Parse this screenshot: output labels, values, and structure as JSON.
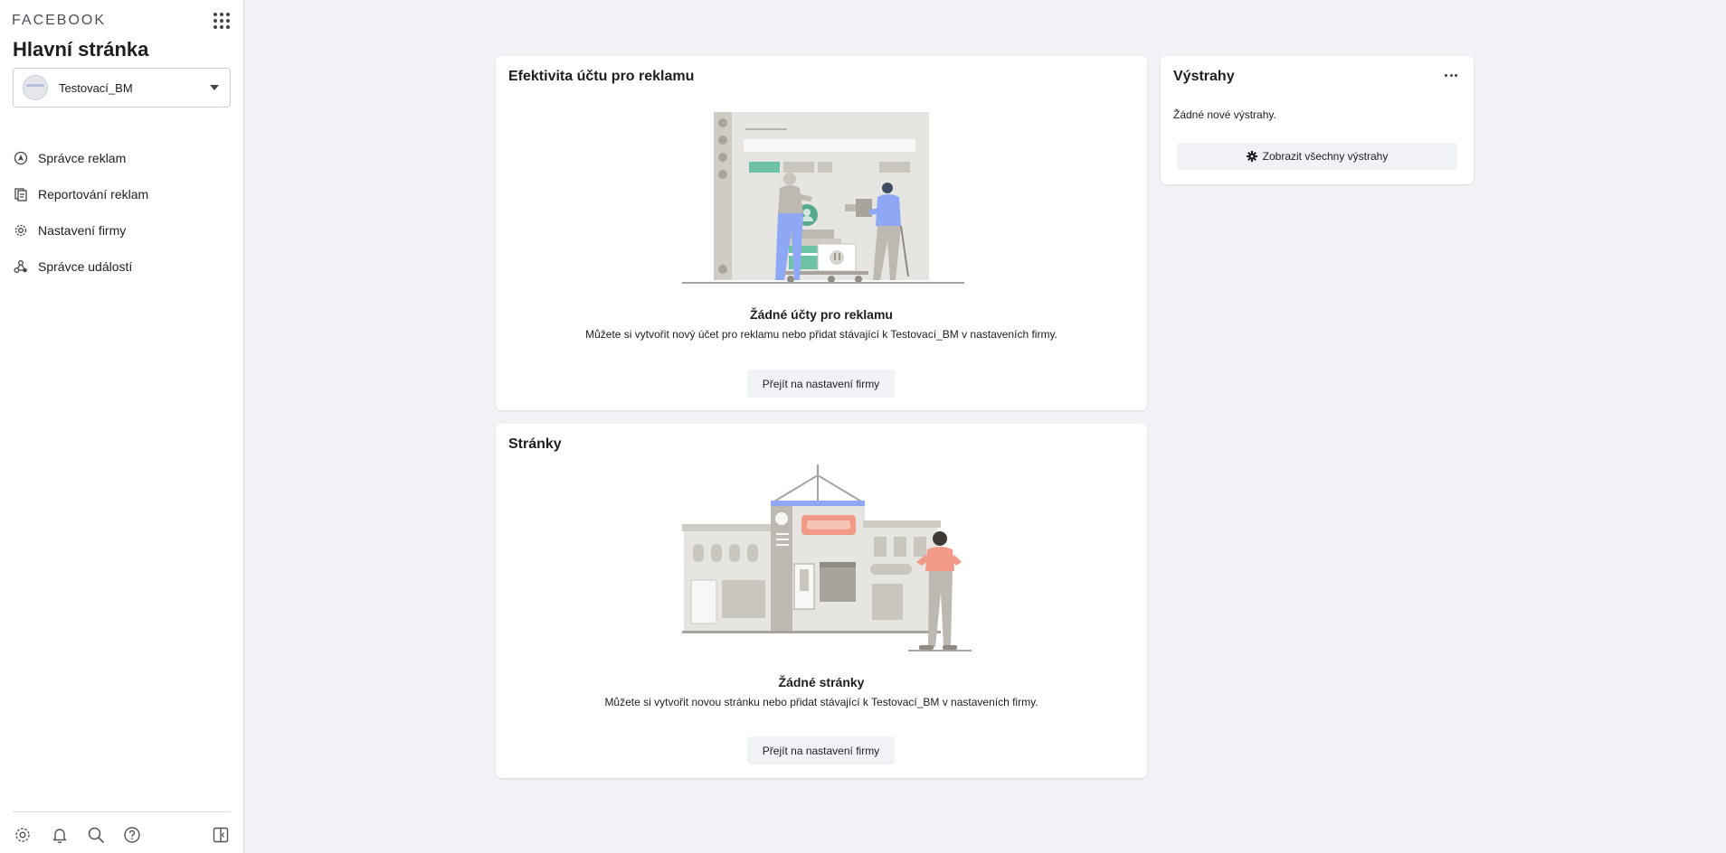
{
  "sidebar": {
    "brand": "FACEBOOK",
    "title": "Hlavní stránka",
    "account": {
      "name": "Testovací_BM"
    },
    "nav_items": [
      {
        "label": "Správce reklam",
        "icon": "ads-manager-icon"
      },
      {
        "label": "Reportování reklam",
        "icon": "ads-reporting-icon"
      },
      {
        "label": "Nastavení firmy",
        "icon": "settings-gear-icon"
      },
      {
        "label": "Správce událostí",
        "icon": "events-manager-icon"
      }
    ],
    "bottom_icons": [
      "settings-icon",
      "notifications-bell-icon",
      "search-icon",
      "help-icon",
      "collapse-sidebar-icon"
    ]
  },
  "ad_accounts_card": {
    "title": "Efektivita účtu pro reklamu",
    "empty_heading": "Žádné účty pro reklamu",
    "empty_desc": "Můžete si vytvořit nový účet pro reklamu nebo přidat stávající k Testovací_BM v nastaveních firmy.",
    "button": "Přejít na nastavení firmy"
  },
  "pages_card": {
    "title": "Stránky",
    "empty_heading": "Žádné stránky",
    "empty_desc": "Můžete si vytvořit novou stránku nebo přidat stávající k Testovací_BM v nastaveních firmy.",
    "button": "Přejít na nastavení firmy"
  },
  "alerts_card": {
    "title": "Výstrahy",
    "empty_text": "Žádné nové výstrahy.",
    "button": "Zobrazit všechny výstrahy"
  },
  "colors": {
    "background": "#f0f2f5",
    "accent_green": "#6dc1a4",
    "accent_blue": "#8fa8f5",
    "accent_salmon": "#f09a87"
  }
}
